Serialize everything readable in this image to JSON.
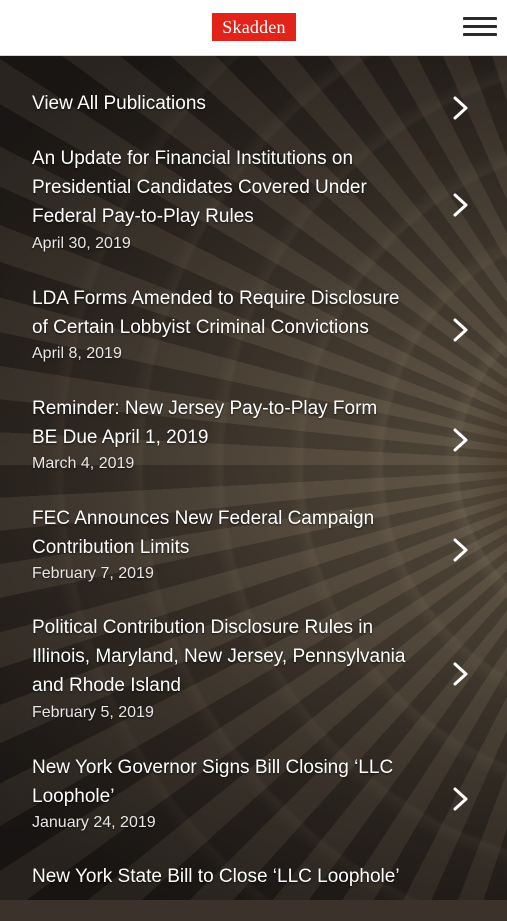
{
  "header": {
    "logo_text": "Skadden",
    "menu_icon": "hamburger-menu-icon"
  },
  "colors": {
    "brand_red": "#e2231a",
    "header_bg": "#ffffff",
    "text": "#ffffff"
  },
  "list": {
    "view_all_label": "View All Publications",
    "items": [
      {
        "title_lines": [
          "An Update for Financial Institutions on",
          "Presidential Candidates Covered Under",
          "Federal Pay-to-Play Rules"
        ],
        "date": "April 30, 2019"
      },
      {
        "title_lines": [
          "LDA Forms Amended to Require Disclosure",
          "of Certain Lobbyist Criminal Convictions"
        ],
        "date": "April 8, 2019"
      },
      {
        "title_lines": [
          "Reminder: New Jersey Pay-to-Play Form",
          "BE Due April 1, 2019"
        ],
        "date": "March 4, 2019"
      },
      {
        "title_lines": [
          "FEC Announces New Federal Campaign",
          "Contribution Limits"
        ],
        "date": "February 7, 2019"
      },
      {
        "title_lines": [
          "Political Contribution Disclosure Rules in",
          "Illinois, Maryland, New Jersey, Pennsylvania",
          "and Rhode Island"
        ],
        "date": "February 5, 2019"
      },
      {
        "title_lines": [
          "New York Governor Signs Bill Closing ‘LLC",
          "Loophole’"
        ],
        "date": "January 24, 2019"
      },
      {
        "title_lines": [
          "New York State Bill to Close ‘LLC Loophole’"
        ],
        "date": ""
      }
    ]
  }
}
